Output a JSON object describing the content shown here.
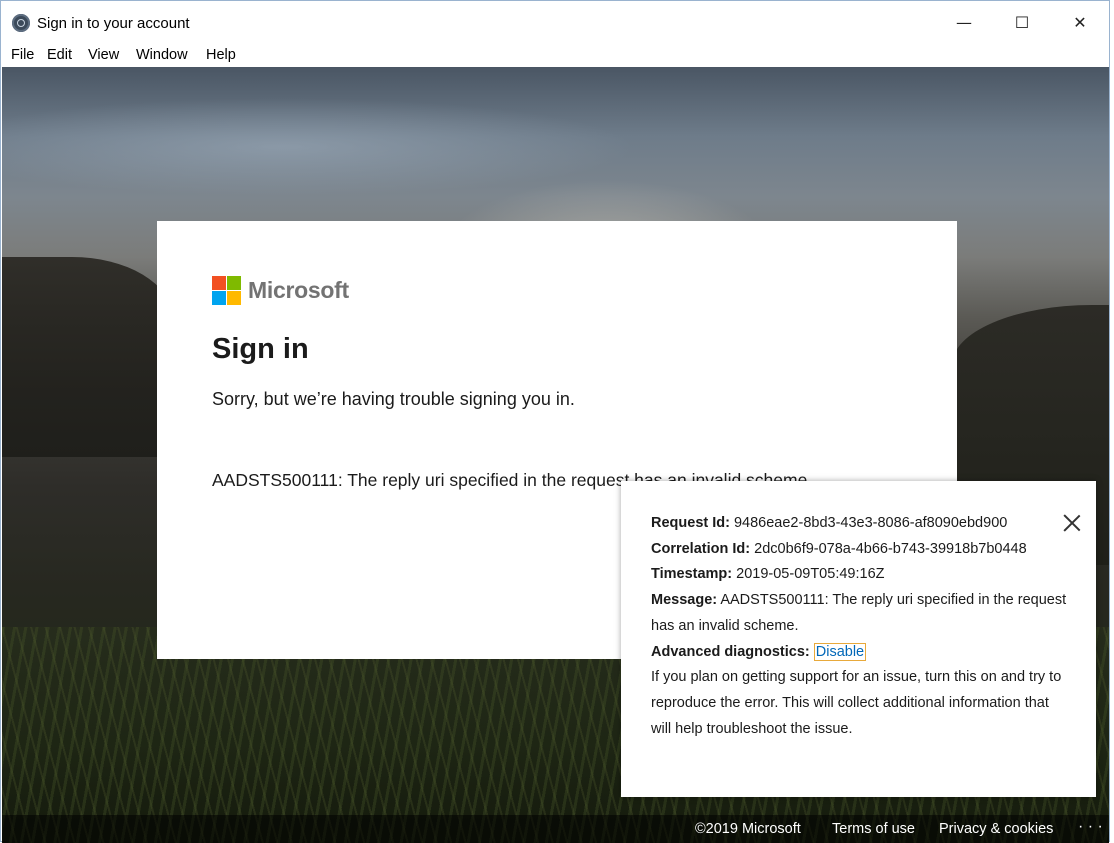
{
  "window": {
    "title": "Sign in to your account",
    "controls": {
      "minimize": "—",
      "maximize": "☐",
      "close": "✕"
    }
  },
  "menu": [
    "File",
    "Edit",
    "View",
    "Window",
    "Help"
  ],
  "card": {
    "brand": "Microsoft",
    "title": "Sign in",
    "subtitle": "Sorry, but we’re having trouble signing you in.",
    "error": "AADSTS500111: The reply uri specified in the request has an invalid scheme."
  },
  "diagnostics": {
    "request_id_label": "Request Id:",
    "request_id": "9486eae2-8bd3-43e3-8086-af8090ebd900",
    "correlation_id_label": "Correlation Id:",
    "correlation_id": "2dc0b6f9-078a-4b66-b743-39918b7b0448",
    "timestamp_label": "Timestamp:",
    "timestamp": "2019-05-09T05:49:16Z",
    "message_label": "Message:",
    "message": "AADSTS500111: The reply uri specified in the request has an invalid scheme.",
    "advanced_label": "Advanced diagnostics:",
    "advanced_link": "Disable",
    "advanced_help": "If you plan on getting support for an issue, turn this on and try to reproduce the error. This will collect additional information that will help troubleshoot the issue."
  },
  "footer": {
    "copyright": "©2019 Microsoft",
    "terms": "Terms of use",
    "privacy": "Privacy & cookies",
    "more": "· · ·"
  }
}
